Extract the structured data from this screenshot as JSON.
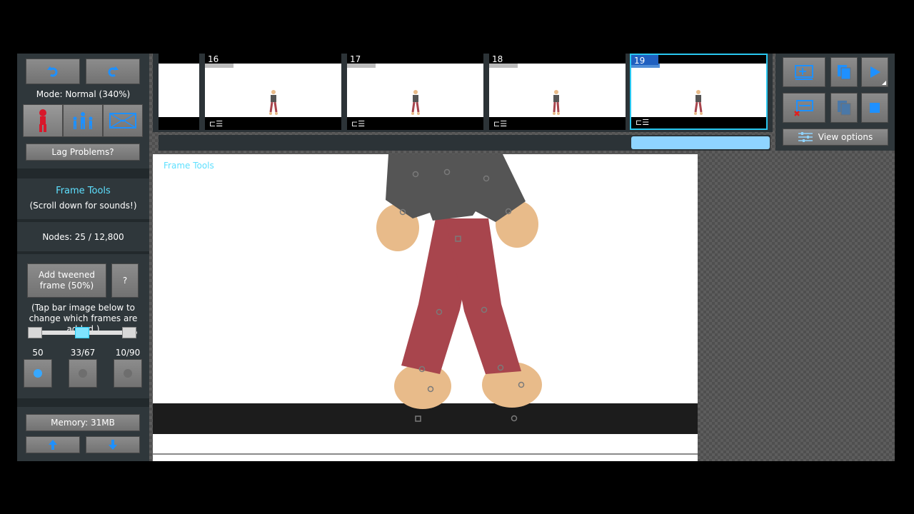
{
  "app": {
    "mode_label": "Mode: Normal (340%)",
    "lag_button": "Lag Problems?",
    "frame_tools_title": "Frame Tools",
    "frame_tools_subtitle": "(Scroll down for sounds!)",
    "nodes_label": "Nodes: 25 / 12,800",
    "add_tween_label": "Add tweened frame (50%)",
    "help_label": "?",
    "tween_hint": "(Tap bar image below to change which frames are added.)",
    "onion": [
      {
        "label": "50"
      },
      {
        "label": "33/67"
      },
      {
        "label": "10/90"
      }
    ],
    "memory_label": "Memory: 31MB",
    "canvas_watermark": "Frame Tools",
    "view_options_label": "View options"
  },
  "timeline": {
    "frames": [
      {
        "number": "16",
        "selected": false
      },
      {
        "number": "17",
        "selected": false
      },
      {
        "number": "18",
        "selected": false
      },
      {
        "number": "19",
        "selected": true
      }
    ],
    "accent": "#29c7f0"
  },
  "colors": {
    "panel": "#2f373b",
    "button": "#808080",
    "accent_cyan": "#5ee0ff",
    "skin": "#e8bb8a",
    "shirt": "#555555",
    "pants": "#a8454d",
    "stickman_red": "#d8182a"
  }
}
